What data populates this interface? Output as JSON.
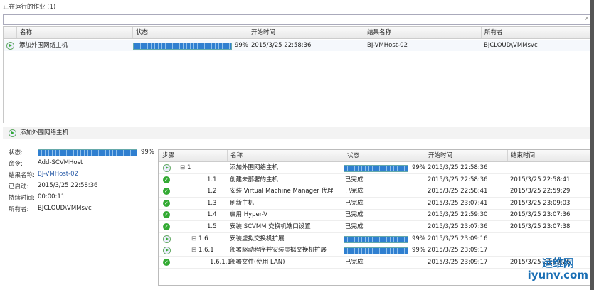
{
  "header": {
    "title": "正在运行的作业 (1)"
  },
  "jobs": {
    "columns": [
      "名称",
      "状态",
      "开始时间",
      "结果名称",
      "所有者"
    ],
    "rows": [
      {
        "name": "添加外围网络主机",
        "progress": 99,
        "progress_label": "99%",
        "start": "2015/3/25 22:58:36",
        "result": "BJ-VMHost-02",
        "owner": "BJCLOUD\\VMMsvc"
      }
    ]
  },
  "detail": {
    "title": "添加外围网络主机",
    "labels": {
      "status": "状态:",
      "command": "命令:",
      "result": "结果名称:",
      "started": "已启动:",
      "duration": "持续时间:",
      "owner": "所有者:"
    },
    "status_progress": 99,
    "status_label": "99%",
    "command": "Add-SCVMHost",
    "result": "BJ-VMHost-02",
    "started": "2015/3/25 22:58:36",
    "duration": "00:00:11",
    "owner": "BJCLOUD\\VMMsvc"
  },
  "steps": {
    "columns": [
      "步骤",
      "名称",
      "状态",
      "开始时间",
      "结束时间"
    ],
    "rows": [
      {
        "step": "1",
        "expander": "⊟",
        "level": 0,
        "icon": "running",
        "name": "添加外围网络主机",
        "status": "",
        "progress": 99,
        "progress_label": "99%",
        "start": "2015/3/25 22:58:36",
        "end": ""
      },
      {
        "step": "1.1",
        "expander": "",
        "level": 1,
        "icon": "done",
        "name": "创建未部署的主机",
        "status": "已完成",
        "start": "2015/3/25 22:58:36",
        "end": "2015/3/25 22:58:41"
      },
      {
        "step": "1.2",
        "expander": "",
        "level": 1,
        "icon": "done",
        "name": "安装 Virtual Machine Manager 代理",
        "status": "已完成",
        "start": "2015/3/25 22:58:41",
        "end": "2015/3/25 22:59:29"
      },
      {
        "step": "1.3",
        "expander": "",
        "level": 1,
        "icon": "done",
        "name": "刷新主机",
        "status": "已完成",
        "start": "2015/3/25 23:07:41",
        "end": "2015/3/25 23:09:03"
      },
      {
        "step": "1.4",
        "expander": "",
        "level": 1,
        "icon": "done",
        "name": "启用 Hyper-V",
        "status": "已完成",
        "start": "2015/3/25 22:59:30",
        "end": "2015/3/25 23:07:36"
      },
      {
        "step": "1.5",
        "expander": "",
        "level": 1,
        "icon": "done",
        "name": "安装 SCVMM 交换机端口设置",
        "status": "已完成",
        "start": "2015/3/25 23:07:36",
        "end": "2015/3/25 23:07:38"
      },
      {
        "step": "1.6",
        "expander": "⊟",
        "level": 1,
        "icon": "running",
        "name": "安装虚拟交换机扩展",
        "status": "",
        "progress": 99,
        "progress_label": "99%",
        "start": "2015/3/25 23:09:16",
        "end": ""
      },
      {
        "step": "1.6.1",
        "expander": "⊟",
        "level": 2,
        "icon": "running",
        "name": "部署驱动程序并安装虚拟交换机扩展",
        "status": "",
        "progress": 99,
        "progress_label": "99%",
        "start": "2015/3/25 23:09:17",
        "end": ""
      },
      {
        "step": "1.6.1.1",
        "expander": "",
        "level": 3,
        "icon": "done",
        "name": "部署文件(使用 LAN)",
        "status": "已完成",
        "start": "2015/3/25 23:09:17",
        "end": "2015/3/25 23:09:26"
      }
    ]
  },
  "watermark": {
    "line1": "运维网",
    "line2": "iyunv.com"
  }
}
